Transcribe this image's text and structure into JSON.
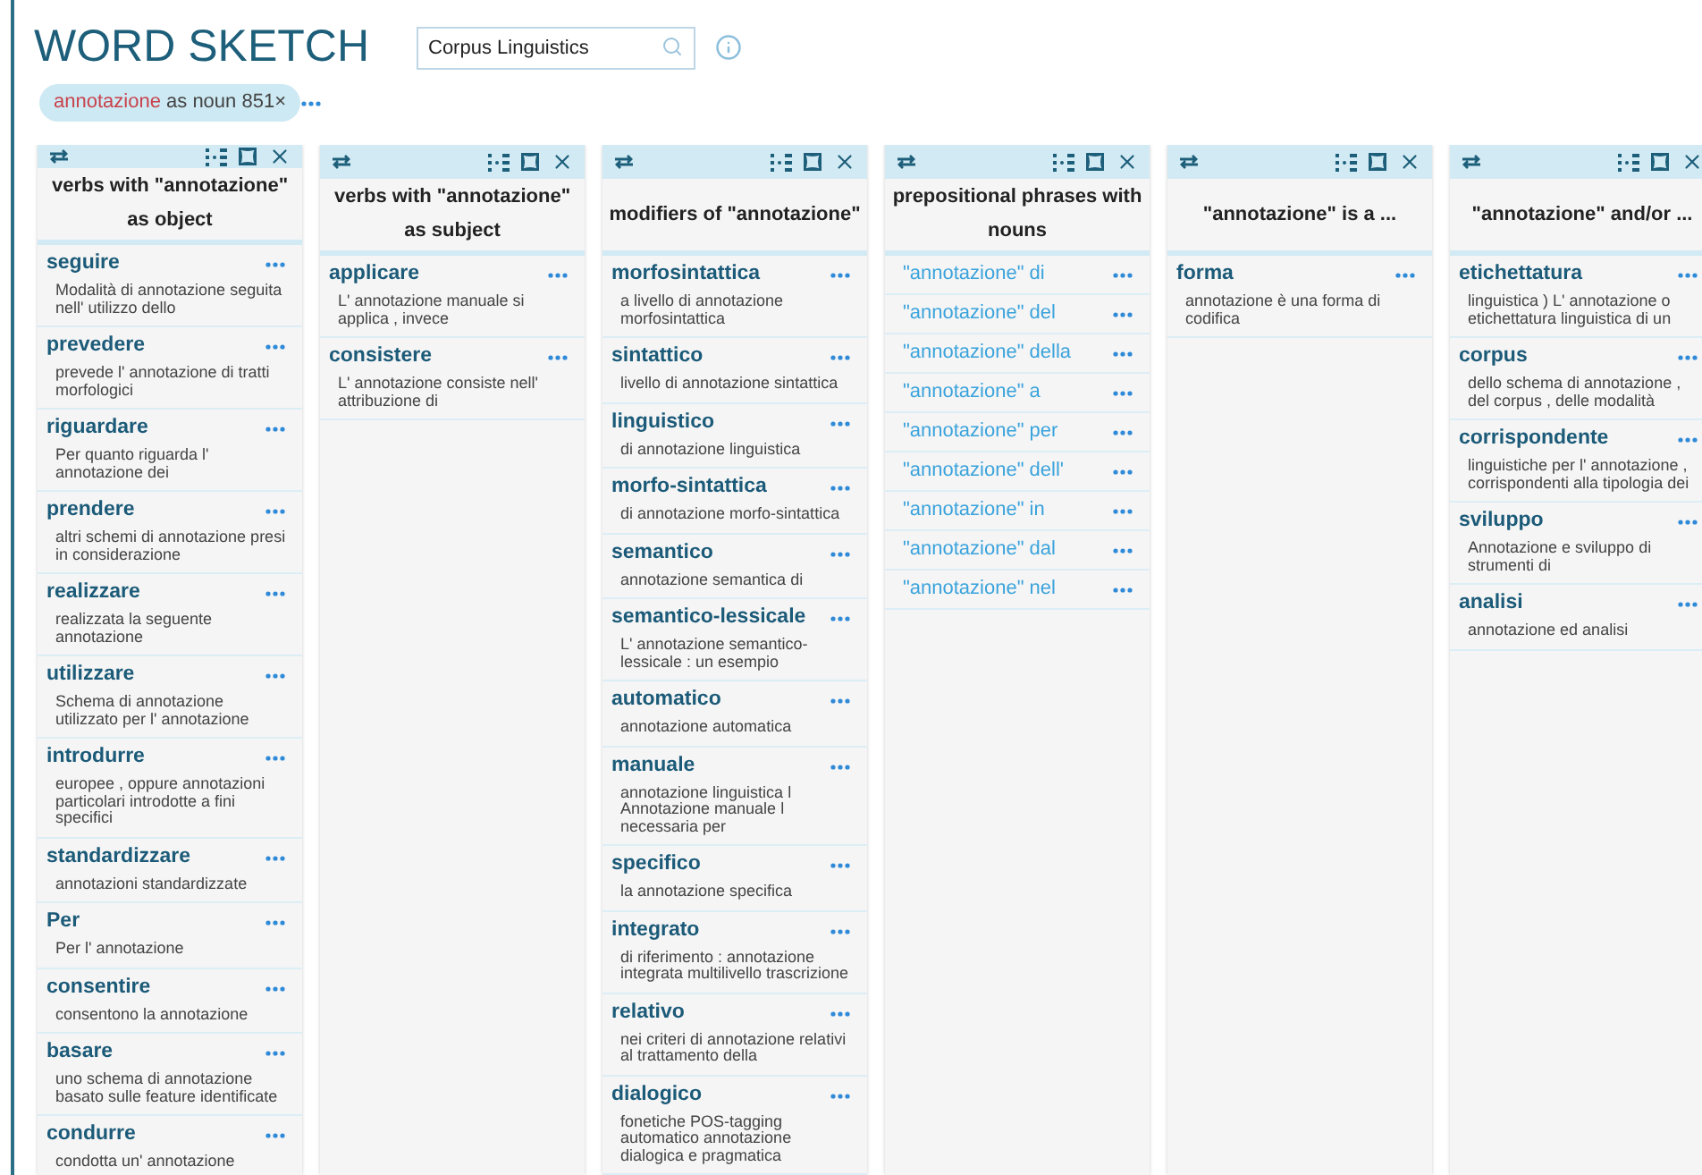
{
  "title": "WORD SKETCH",
  "search": {
    "value": "Corpus Linguistics"
  },
  "chip": {
    "word": "annotazione",
    "rest": "as noun 851×"
  },
  "columns": [
    {
      "kind": "collocations",
      "title": "verbs with \"annotazione\" as object",
      "rows": [
        {
          "word": "seguire",
          "example": "Modalità di annotazione seguita nell' utilizzo dello"
        },
        {
          "word": "prevedere",
          "example": "prevede l' annotazione di tratti morfologici"
        },
        {
          "word": "riguardare",
          "example": "Per quanto riguarda l' annotazione dei"
        },
        {
          "word": "prendere",
          "example": "altri schemi di annotazione presi in considerazione"
        },
        {
          "word": "realizzare",
          "example": "realizzata la seguente annotazione"
        },
        {
          "word": "utilizzare",
          "example": "Schema di annotazione utilizzato per l' annotazione"
        },
        {
          "word": "introdurre",
          "example": "europee , oppure annotazioni particolari introdotte a fini specifici"
        },
        {
          "word": "standardizzare",
          "example": "annotazioni standardizzate"
        },
        {
          "word": "Per",
          "example": "Per l' annotazione"
        },
        {
          "word": "consentire",
          "example": "consentono la annotazione"
        },
        {
          "word": "basare",
          "example": "uno schema di annotazione basato sulle feature identificate"
        },
        {
          "word": "condurre",
          "example": "condotta un' annotazione"
        }
      ]
    },
    {
      "kind": "collocations",
      "title": "verbs with \"annotazione\" as subject",
      "rows": [
        {
          "word": "applicare",
          "example": "L' annotazione manuale si applica , invece"
        },
        {
          "word": "consistere",
          "example": "L' annotazione consiste nell' attribuzione di"
        }
      ]
    },
    {
      "kind": "collocations",
      "title": "modifiers of \"annotazione\"",
      "rows": [
        {
          "word": "morfosintattica",
          "example": "a livello di annotazione morfosintattica"
        },
        {
          "word": "sintattico",
          "example": "livello di annotazione sintattica"
        },
        {
          "word": "linguistico",
          "example": "di annotazione linguistica"
        },
        {
          "word": "morfo-sintattica",
          "example": "di annotazione morfo-sintattica"
        },
        {
          "word": "semantico",
          "example": "annotazione semantica di"
        },
        {
          "word": "semantico-lessicale",
          "example": "L' annotazione semantico-lessicale : un esempio"
        },
        {
          "word": "automatico",
          "example": "annotazione automatica"
        },
        {
          "word": "manuale",
          "example": "annotazione linguistica l Annotazione manuale l necessaria per"
        },
        {
          "word": "specifico",
          "example": "la annotazione specifica"
        },
        {
          "word": "integrato",
          "example": "di riferimento : annotazione integrata multilivello trascrizione"
        },
        {
          "word": "relativo",
          "example": "nei criteri di annotazione relativi al trattamento della"
        },
        {
          "word": "dialogico",
          "example": "fonetiche POS-tagging automatico annotazione dialogica e pragmatica"
        }
      ]
    },
    {
      "kind": "phrases",
      "title": "prepositional phrases with nouns",
      "rows": [
        {
          "word": "\"annotazione\" di"
        },
        {
          "word": "\"annotazione\" del"
        },
        {
          "word": "\"annotazione\" della"
        },
        {
          "word": "\"annotazione\" a"
        },
        {
          "word": "\"annotazione\" per"
        },
        {
          "word": "\"annotazione\" dell'"
        },
        {
          "word": "\"annotazione\" in"
        },
        {
          "word": "\"annotazione\" dal"
        },
        {
          "word": "\"annotazione\" nel"
        }
      ]
    },
    {
      "kind": "collocations",
      "title": "\"annotazione\" is a ...",
      "rows": [
        {
          "word": "forma",
          "example": "annotazione è una forma di codifica"
        }
      ]
    },
    {
      "kind": "collocations",
      "title": "\"annotazione\" and/or ...",
      "rows": [
        {
          "word": "etichettatura",
          "example": "linguistica ) L' annotazione o etichettatura linguistica di un"
        },
        {
          "word": "corpus",
          "example": "dello schema di annotazione , del corpus , delle modalità"
        },
        {
          "word": "corrispondente",
          "example": "linguistiche per l' annotazione , corrispondenti alla tipologia dei"
        },
        {
          "word": "sviluppo",
          "example": "Annotazione e sviluppo di strumenti di"
        },
        {
          "word": "analisi",
          "example": "annotazione ed analisi"
        }
      ]
    }
  ]
}
